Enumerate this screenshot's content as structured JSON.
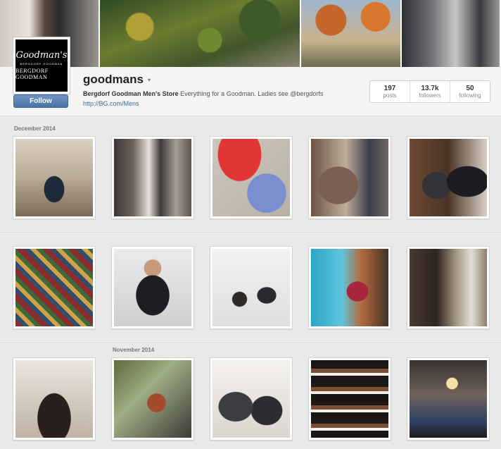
{
  "profile": {
    "username": "goodmans",
    "avatar_script": "Goodman's",
    "avatar_small": "BERGDORF GOODMAN",
    "avatar_brand": "BERGDORF GOODMAN",
    "follow_label": "Follow",
    "bio_name": "Bergdorf Goodman Men's Store",
    "bio_text": " Everything for a Goodman. Ladies see @bergdorfs",
    "link": "http://BG.com/Mens"
  },
  "stats": [
    {
      "value": "197",
      "label": "posts"
    },
    {
      "value": "13.7k",
      "label": "followers"
    },
    {
      "value": "50",
      "label": "following"
    }
  ],
  "months": {
    "december": "December 2014",
    "november": "November 2014"
  },
  "photos": [
    "archway-window",
    "store-interior",
    "sweaters",
    "tweed-jacket",
    "tuxedo-display",
    "plaid-scarves",
    "bearded-man",
    "snow-figures",
    "colorful-display",
    "shoe-wall",
    "leather-backpacks",
    "headphones-man",
    "suit-display",
    "shoe-shelves",
    "restaurant"
  ]
}
